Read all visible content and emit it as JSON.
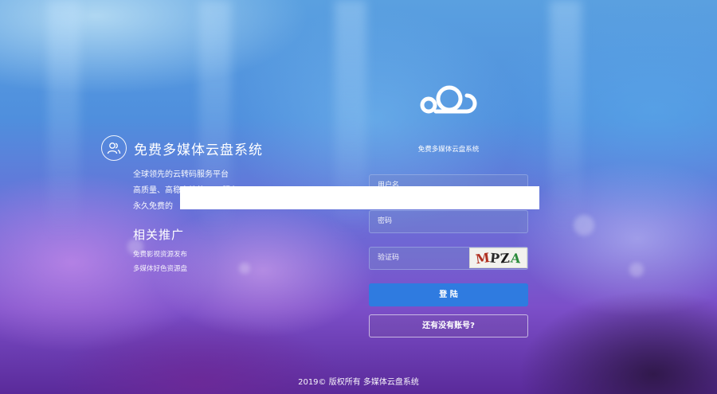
{
  "intro": {
    "title": "免费多媒体云盘系统",
    "lines": [
      "全球领先的云转码服务平台",
      "高质量、高稳定性的CDN服务",
      "永久免费的"
    ],
    "related_title": "相关推广",
    "related_lines": [
      "免费影视资源发布",
      "多媒体好色资源盘"
    ]
  },
  "form": {
    "brand": "免费多媒体云盘系统",
    "username_placeholder": "用户名",
    "password_placeholder": "密码",
    "captcha_placeholder": "验证码",
    "captcha_text": [
      "M",
      "P",
      "Z",
      "A"
    ],
    "login_label": "登 陆",
    "register_label": "还有没有账号?"
  },
  "footer": "2019© 版权所有 多媒体云盘系统",
  "colors": {
    "login_button": "#2f7be0",
    "captcha_letters": [
      "#b03020",
      "#2a2a2a",
      "#1a1a1a",
      "#2a8a3a"
    ]
  }
}
